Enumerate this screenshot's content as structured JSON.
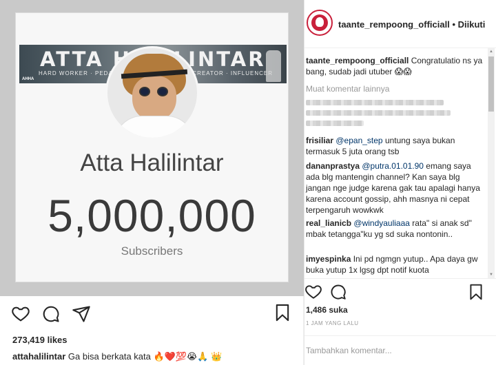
{
  "post": {
    "banner_title": "ATTA HALILINTAR",
    "banner_sub_left": "HARD WORKER · PEDAGO",
    "banner_sub_right": "CREATOR · INFLUENCER",
    "banner_tag": "AHHA",
    "channel_name": "Atta Halilintar",
    "subscriber_count": "5,000,000",
    "subscriber_label": "Subscribers"
  },
  "left_bar": {
    "likes": "273,419 likes",
    "caption_user": "attahalilintar",
    "caption_text": "Ga bisa berkata kata 🔥❤️💯😭🙏 👑"
  },
  "sidebar": {
    "header": {
      "username": "taante_rempoong_officiall",
      "separator": "•",
      "follow_status": "Diikuti"
    },
    "comments": [
      {
        "user": "taante_rempoong_officiall",
        "mention": "",
        "text": "Congratulatio ns ya bang, sudab jadi utuber 😱😱"
      },
      {
        "user": "frisiliar",
        "mention": "@epan_step",
        "text": "untung saya bukan termasuk 5 juta orang tsb"
      },
      {
        "user": "dananprastya",
        "mention": "@putra.01.01.90",
        "text": "emang saya ada blg mantengin channel? Kan saya blg jangan nge judge karena gak tau apalagi hanya karena account gossip, ahh masnya ni cepat terpengaruh wowkwk"
      },
      {
        "user": "real_lianicb",
        "mention": "@windyauliaaa",
        "text": "rata\" si anak sd\" mbak tetangga\"ku yg sd suka nontonin.."
      },
      {
        "user": "imyespinka",
        "mention": "",
        "text": "Ini pd ngmgn yutup.. Apa daya gw buka yutup 1x lgsg dpt notif kuota"
      }
    ],
    "load_more": "Muat komentar lainnya",
    "likes": "1,486 suka",
    "timestamp": "1 JAM YANG LALU",
    "comment_placeholder": "Tambahkan komentar..."
  },
  "icons": [
    "heart-icon",
    "comment-icon",
    "share-icon",
    "bookmark-icon"
  ],
  "colors": {
    "link": "#003569",
    "muted": "#999999",
    "profile_ring": "#c9203b"
  }
}
